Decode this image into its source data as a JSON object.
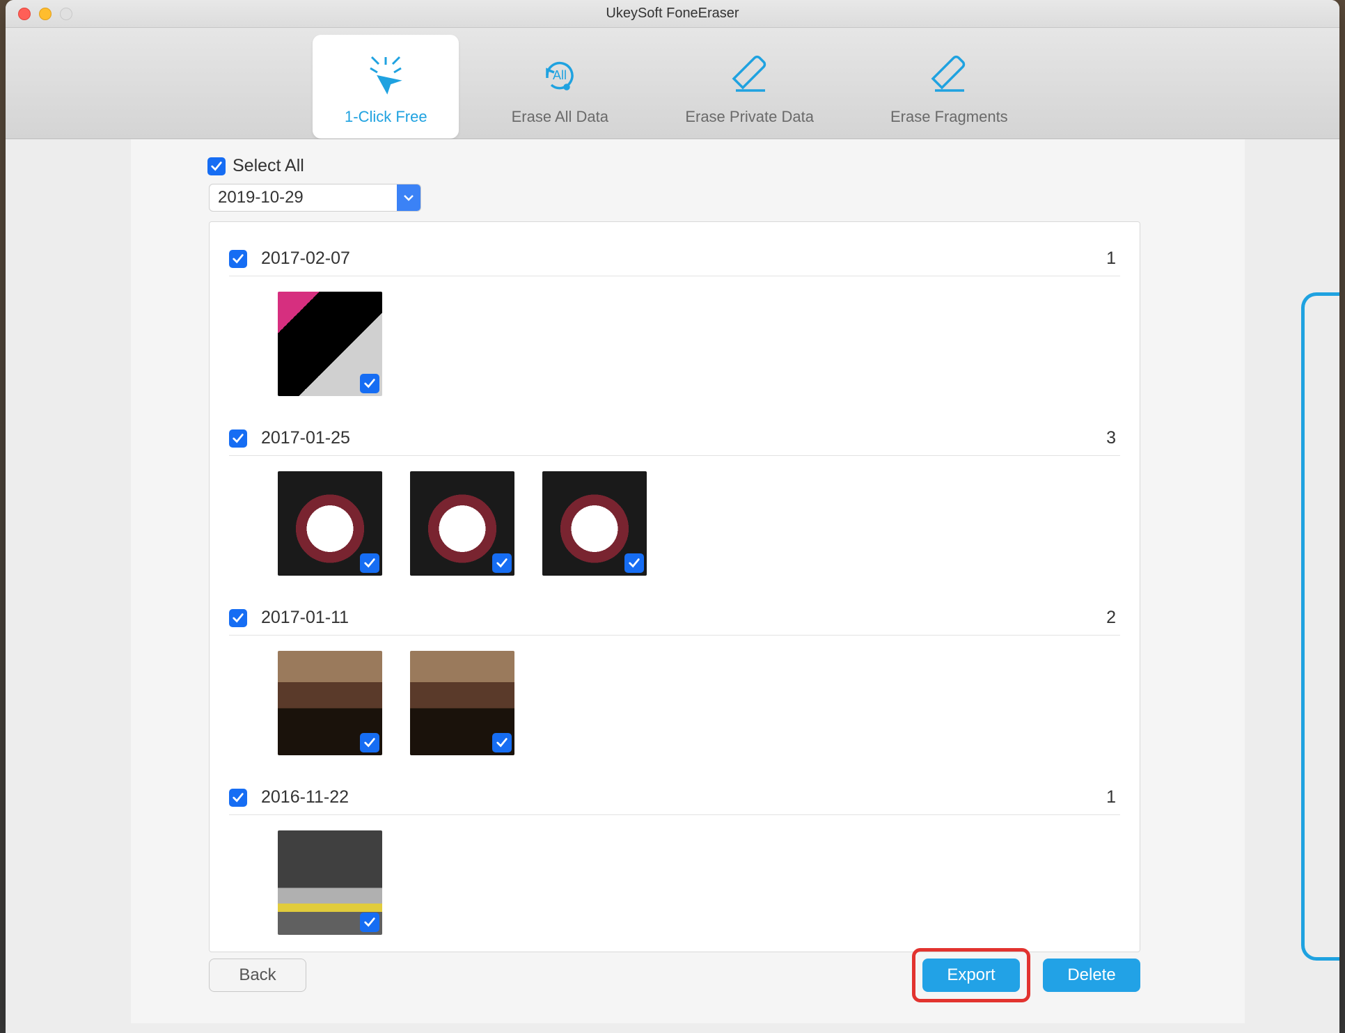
{
  "window": {
    "title": "UkeySoft FoneEraser"
  },
  "tabs": [
    {
      "label": "1-Click Free",
      "active": true
    },
    {
      "label": "Erase All Data",
      "active": false
    },
    {
      "label": "Erase Private Data",
      "active": false
    },
    {
      "label": "Erase Fragments",
      "active": false
    }
  ],
  "selectAllLabel": "Select All",
  "dateFilter": "2019-10-29",
  "groups": [
    {
      "date": "2017-02-07",
      "count": 1,
      "thumbs": [
        "ph1"
      ]
    },
    {
      "date": "2017-01-25",
      "count": 3,
      "thumbs": [
        "ph-cat",
        "ph-cat",
        "ph-cat"
      ]
    },
    {
      "date": "2017-01-11",
      "count": 2,
      "thumbs": [
        "ph-person",
        "ph-person"
      ]
    },
    {
      "date": "2016-11-22",
      "count": 1,
      "thumbs": [
        "ph-car"
      ]
    }
  ],
  "buttons": {
    "back": "Back",
    "export": "Export",
    "delete": "Delete"
  }
}
